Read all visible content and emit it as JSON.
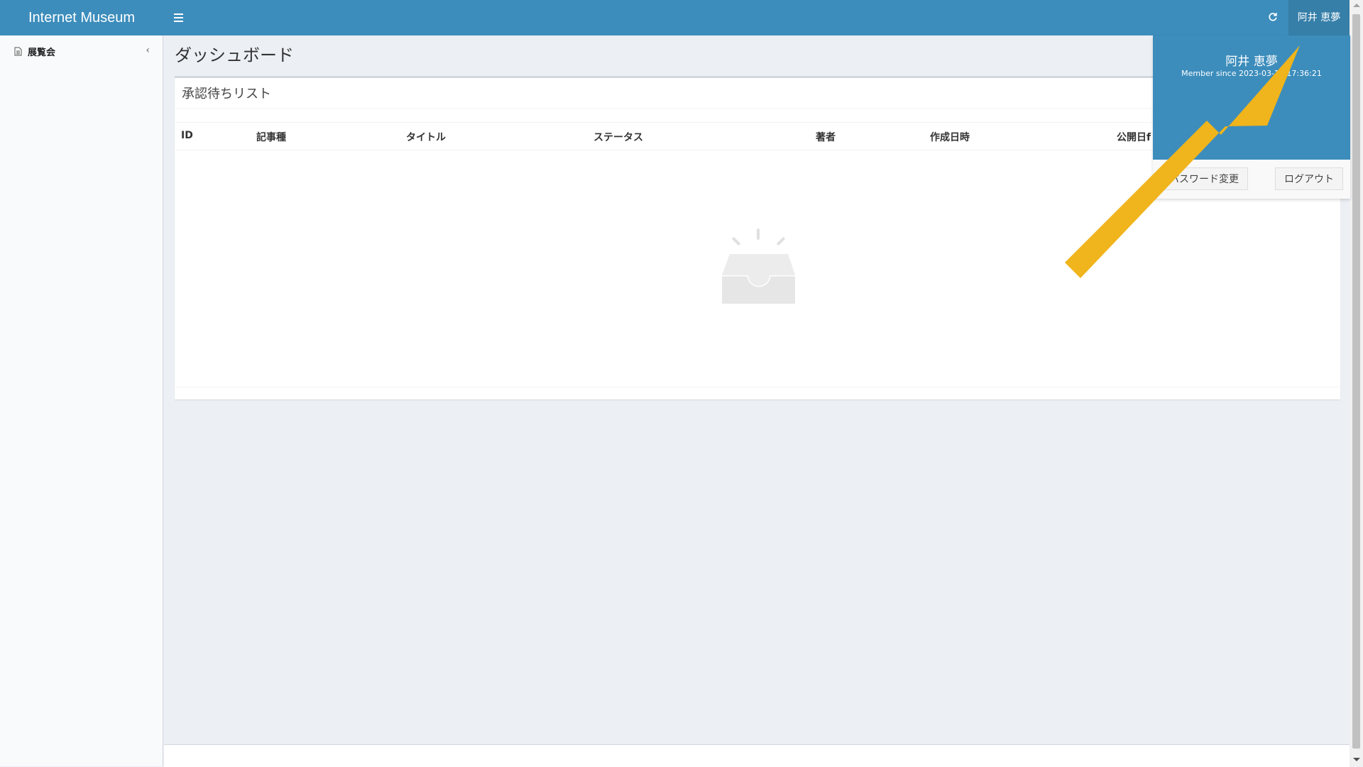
{
  "header": {
    "brand": "Internet Museum",
    "user_button_label": "阿井 恵夢"
  },
  "sidebar": {
    "items": [
      {
        "label": "展覧会",
        "icon": "document-icon"
      }
    ]
  },
  "main": {
    "page_title": "ダッシュボード",
    "box": {
      "title": "承認待ちリスト",
      "columns": [
        "ID",
        "記事種",
        "タイトル",
        "ステータス",
        "著者",
        "作成日時",
        "公開日f"
      ]
    }
  },
  "dropdown": {
    "user_name": "阿井 恵夢",
    "member_since": "Member since 2023-03-13 17:36:21",
    "password_button": "パスワード変更",
    "logout_button": "ログアウト"
  },
  "colors": {
    "header_bg": "#3c8dbc",
    "arrow": "#f0b41c"
  }
}
